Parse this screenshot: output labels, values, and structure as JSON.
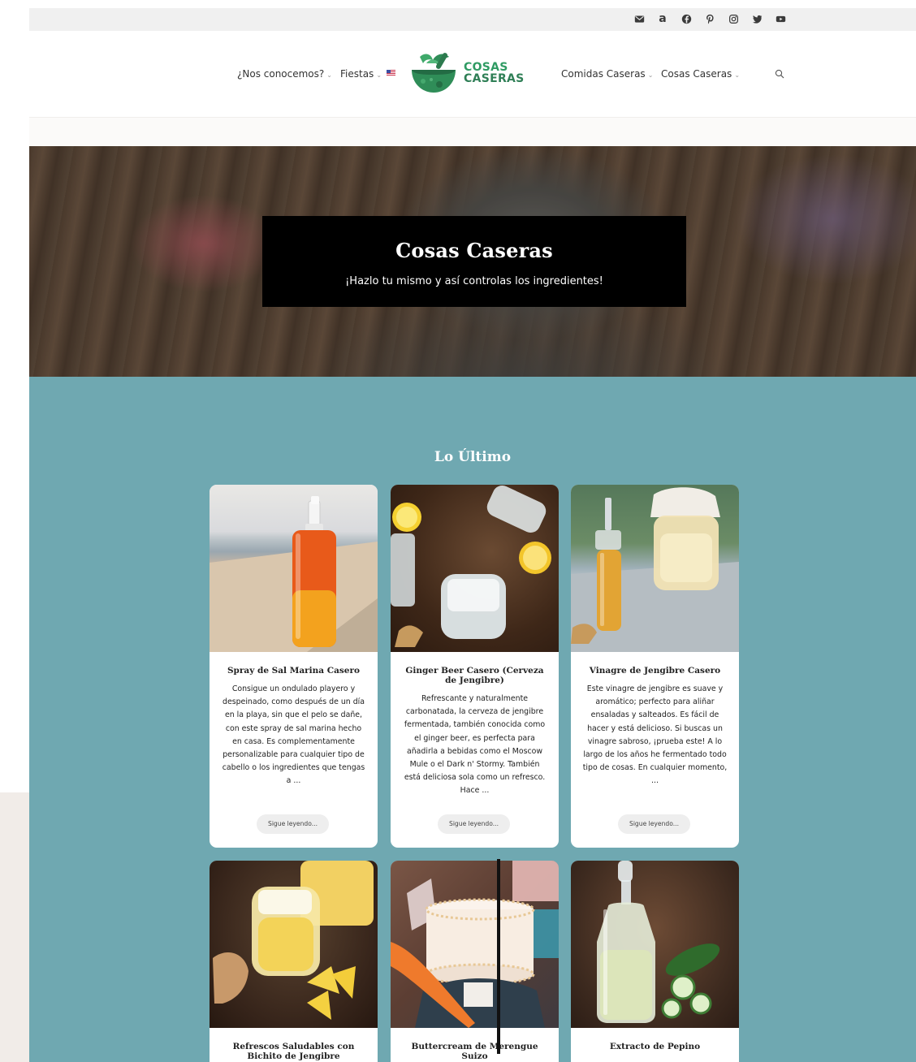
{
  "social": {
    "icons": [
      "email-icon",
      "amazon-icon",
      "facebook-icon",
      "pinterest-icon",
      "instagram-icon",
      "twitter-icon",
      "youtube-icon"
    ]
  },
  "nav": {
    "about": "¿Nos conocemos?",
    "parties": "Fiestas",
    "home_food": "Comidas Caseras",
    "home_things": "Cosas Caseras"
  },
  "logo": {
    "line1": "COSAS",
    "line2": "CASERAS"
  },
  "hero": {
    "title": "Cosas Caseras",
    "subtitle": "¡Hazlo tu mismo y así controlas los ingredientes!"
  },
  "latest": {
    "title": "Lo Último",
    "read_more": "Sigue leyendo...",
    "posts": [
      {
        "title": "Spray de Sal Marina Casero",
        "excerpt": "Consigue un ondulado playero y despeinado, como después de un día en la playa, sin que el pelo se dañe, con este spray de sal marina hecho en casa. Es complementamente personalizable para cualquier tipo de cabello o los ingredientes que tengas a ..."
      },
      {
        "title": "Ginger Beer Casero (Cerveza de Jengibre)",
        "excerpt": "Refrescante y naturalmente carbonatada, la cerveza de jengibre fermentada, también conocida como el ginger beer, es perfecta para añadirla a bebidas como el Moscow Mule o el Dark n' Stormy. También está deliciosa sola como un refresco. Hace ..."
      },
      {
        "title": "Vinagre de Jengibre Casero",
        "excerpt": "Este vinagre de jengibre es suave y aromático; perfecto para aliñar ensaladas y salteados. Es fácil de hacer y está delicioso. Si buscas un vinagre sabroso, ¡prueba este! A lo largo de los años he fermentado todo tipo de cosas. En cualquier momento, ..."
      },
      {
        "title": "Refrescos Saludables con Bichito de Jengibre",
        "excerpt": ""
      },
      {
        "title": "Buttercream de Merengue Suizo",
        "excerpt": ""
      },
      {
        "title": "Extracto de Pepino",
        "excerpt": ""
      }
    ]
  }
}
